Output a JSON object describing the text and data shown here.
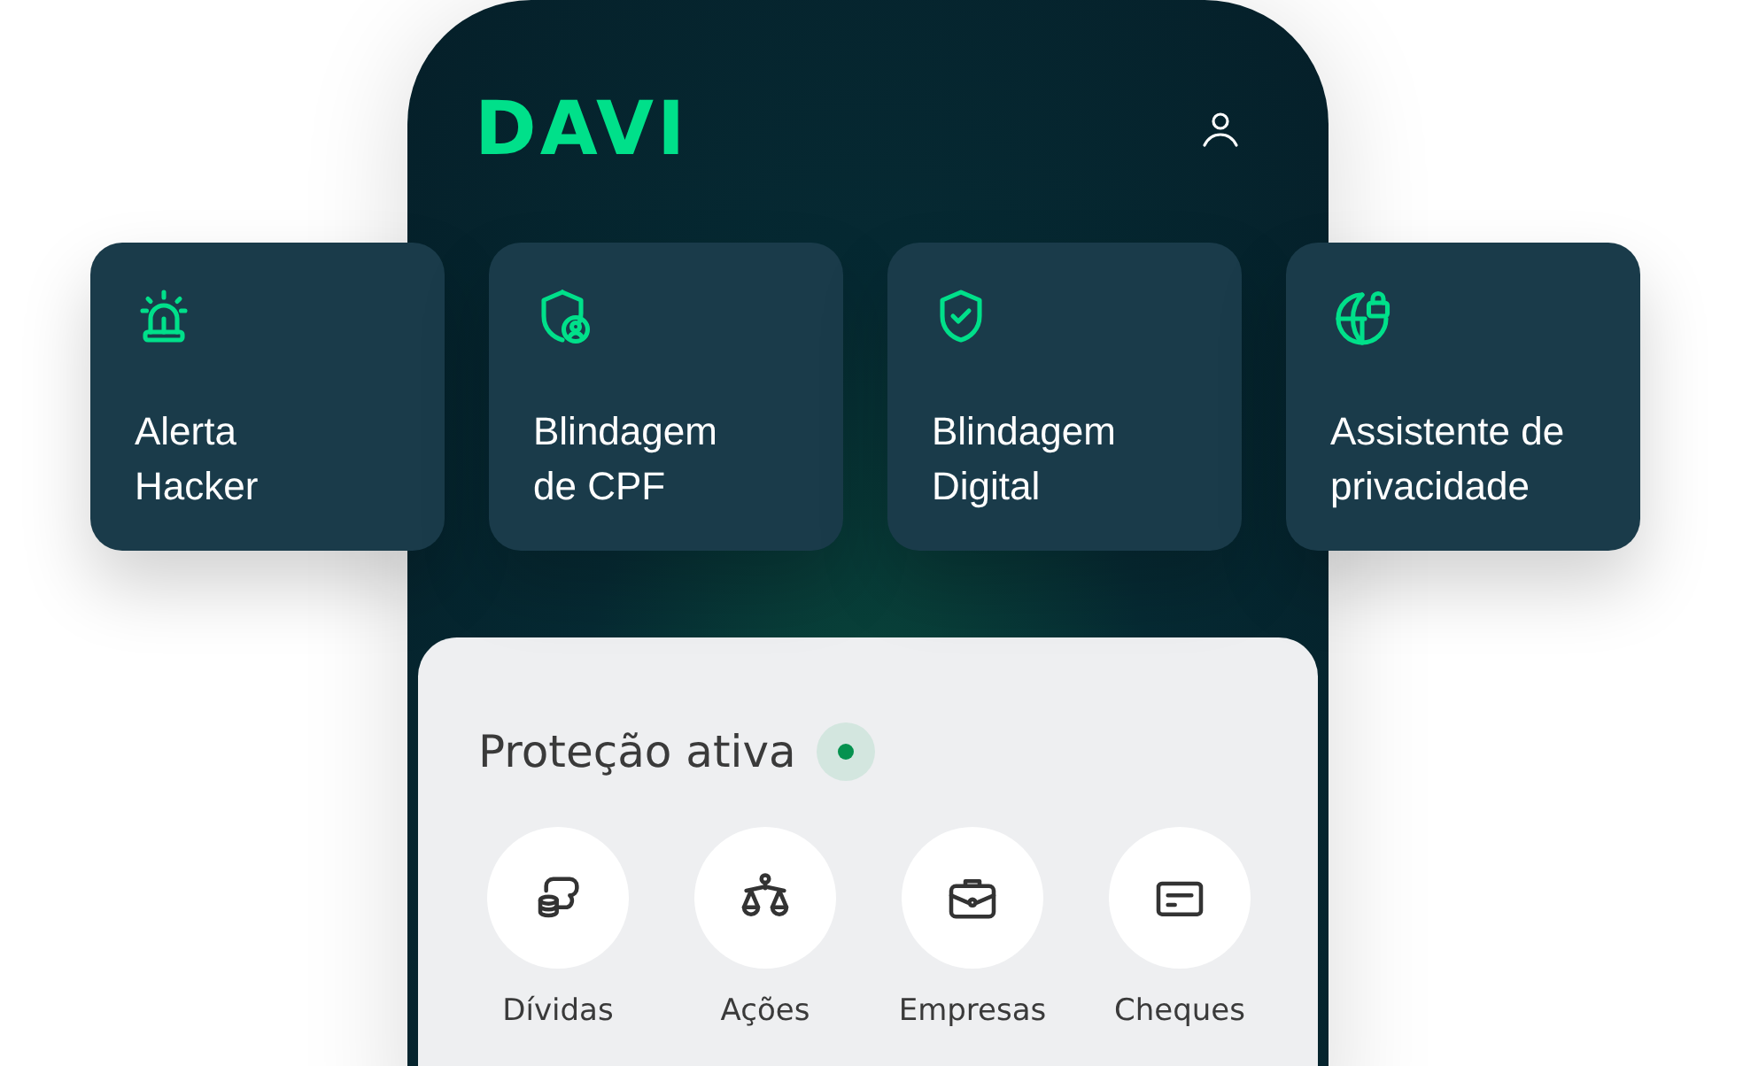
{
  "header": {
    "logo": "DAVI"
  },
  "features": [
    {
      "label": "Alerta Hacker"
    },
    {
      "label": "Blindagem de CPF"
    },
    {
      "label": "Blindagem Digital"
    },
    {
      "label": "Assistente de privacidade"
    }
  ],
  "protection": {
    "title": "Proteção ativa",
    "active": true,
    "categories": [
      {
        "label": "Dívidas"
      },
      {
        "label": "Ações"
      },
      {
        "label": "Empresas"
      },
      {
        "label": "Cheques"
      }
    ]
  }
}
